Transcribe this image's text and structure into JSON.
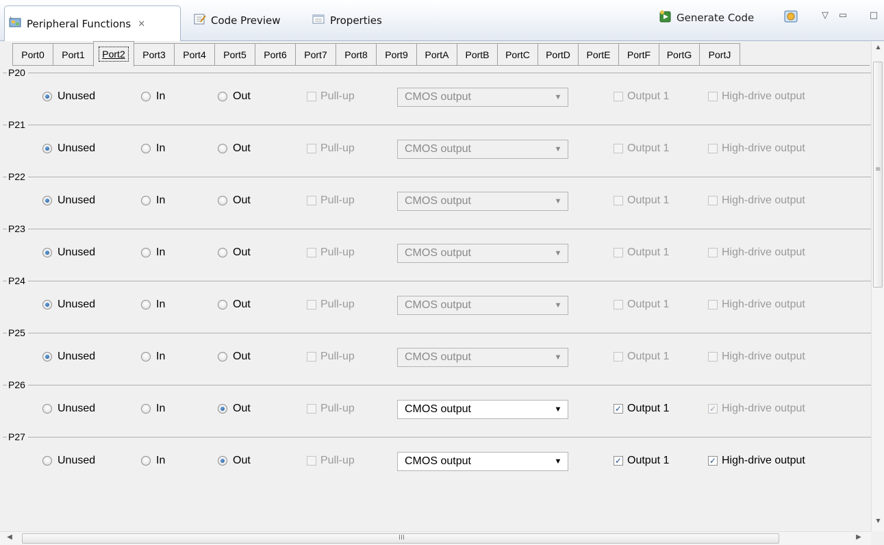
{
  "view_tabs": [
    {
      "label": "Peripheral Functions",
      "icon": "peripheral-functions-icon",
      "active": true
    },
    {
      "label": "Code Preview",
      "icon": "code-preview-icon",
      "active": false
    },
    {
      "label": "Properties",
      "icon": "properties-icon",
      "active": false
    }
  ],
  "toolbar": {
    "close_glyph": "✕",
    "generate_label": "Generate Code",
    "menu_glyph": "▽",
    "minimize_glyph": "▭",
    "maximize_glyph": "□"
  },
  "port_tabs": [
    "Port0",
    "Port1",
    "Port2",
    "Port3",
    "Port4",
    "Port5",
    "Port6",
    "Port7",
    "Port8",
    "Port9",
    "PortA",
    "PortB",
    "PortC",
    "PortD",
    "PortE",
    "PortF",
    "PortG",
    "PortJ"
  ],
  "active_port_tab": "Port2",
  "labels": {
    "unused": "Unused",
    "in": "In",
    "out": "Out",
    "pullup": "Pull-up",
    "output1": "Output 1",
    "high_drive": "High-drive output"
  },
  "pins": [
    {
      "name": "P20",
      "mode": "Unused",
      "pullup": false,
      "output_type": "CMOS output",
      "output1": false,
      "high_drive": false
    },
    {
      "name": "P21",
      "mode": "Unused",
      "pullup": false,
      "output_type": "CMOS output",
      "output1": false,
      "high_drive": false
    },
    {
      "name": "P22",
      "mode": "Unused",
      "pullup": false,
      "output_type": "CMOS output",
      "output1": false,
      "high_drive": false
    },
    {
      "name": "P23",
      "mode": "Unused",
      "pullup": false,
      "output_type": "CMOS output",
      "output1": false,
      "high_drive": false
    },
    {
      "name": "P24",
      "mode": "Unused",
      "pullup": false,
      "output_type": "CMOS output",
      "output1": false,
      "high_drive": false
    },
    {
      "name": "P25",
      "mode": "Unused",
      "pullup": false,
      "output_type": "CMOS output",
      "output1": false,
      "high_drive": false
    },
    {
      "name": "P26",
      "mode": "Out",
      "pullup": false,
      "output_type": "CMOS output",
      "output1": true,
      "high_drive": true
    },
    {
      "name": "P27",
      "mode": "Out",
      "pullup": false,
      "output_type": "CMOS output",
      "output1": true,
      "high_drive": true
    }
  ],
  "colors": {
    "radio_selected": "#1d4f8c",
    "check_mark": "#1f4e8a",
    "disabled_text": "#9a9a9a"
  }
}
